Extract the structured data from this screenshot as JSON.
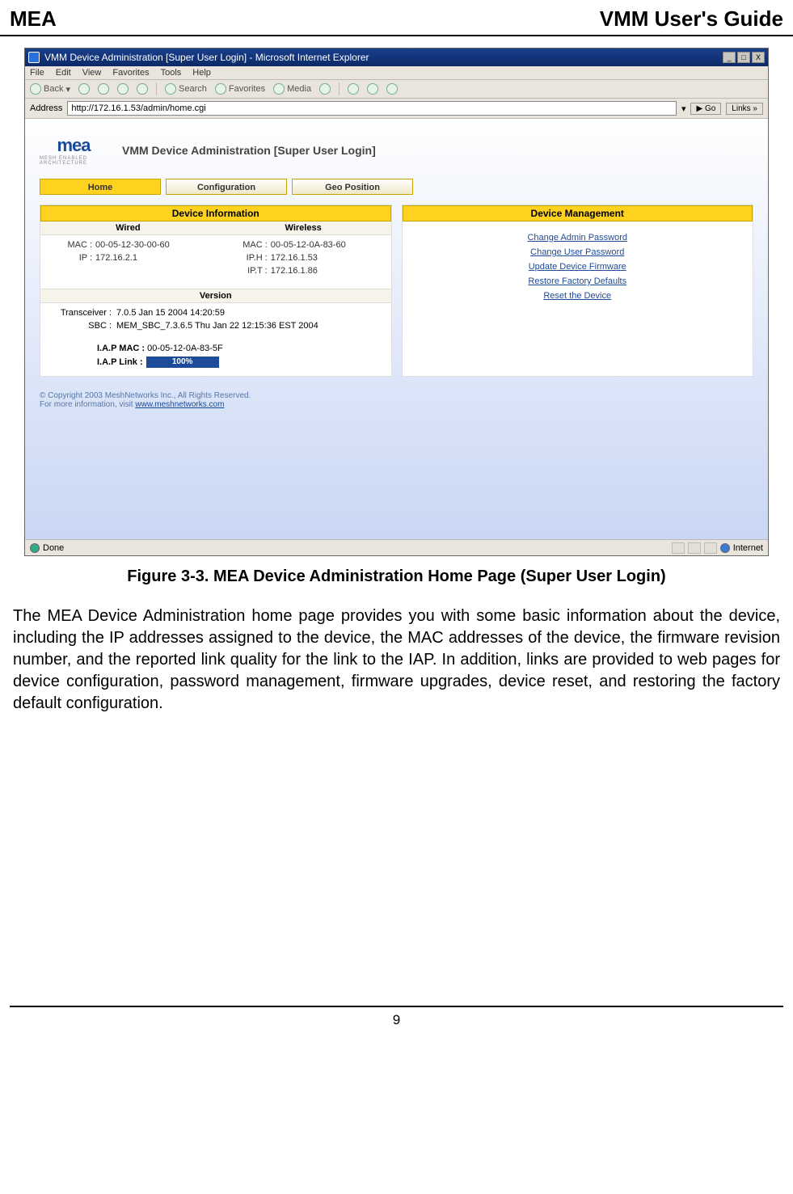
{
  "doc_header": {
    "left": "MEA",
    "right": "VMM User's Guide"
  },
  "titlebar": {
    "text": "VMM Device Administration [Super User Login] - Microsoft Internet Explorer"
  },
  "win_btns": {
    "min": "_",
    "max": "□",
    "close": "X"
  },
  "menubar": [
    "File",
    "Edit",
    "View",
    "Favorites",
    "Tools",
    "Help"
  ],
  "toolbar": {
    "back": "Back",
    "search": "Search",
    "favorites": "Favorites",
    "media": "Media"
  },
  "addressbar": {
    "label": "Address",
    "url": "http://172.16.1.53/admin/home.cgi",
    "go": "Go",
    "links": "Links"
  },
  "app_title": "VMM Device Administration [Super User Login]",
  "logo": {
    "text": "mea",
    "sub": "MESH ENABLED ARCHITECTURE"
  },
  "tabs": {
    "home": "Home",
    "config": "Configuration",
    "geo": "Geo Position"
  },
  "device_info": {
    "header": "Device Information",
    "wired_h": "Wired",
    "wireless_h": "Wireless",
    "wired": {
      "mac_k": "MAC :",
      "mac_v": "00-05-12-30-00-60",
      "ip_k": "IP :",
      "ip_v": "172.16.2.1"
    },
    "wireless": {
      "mac_k": "MAC :",
      "mac_v": "00-05-12-0A-83-60",
      "iph_k": "IP.H :",
      "iph_v": "172.16.1.53",
      "ipt_k": "IP.T :",
      "ipt_v": "172.16.1.86"
    },
    "version_h": "Version",
    "version": {
      "trans_k": "Transceiver :",
      "trans_v": "7.0.5 Jan 15 2004 14:20:59",
      "sbc_k": "SBC :",
      "sbc_v": "MEM_SBC_7.3.6.5 Thu Jan 22 12:15:36 EST 2004"
    },
    "iap": {
      "mac_k": "I.A.P MAC :",
      "mac_v": "00-05-12-0A-83-5F",
      "link_k": "I.A.P Link :",
      "link_v": "100%"
    }
  },
  "device_mgmt": {
    "header": "Device Management",
    "links": {
      "admin_pw": "Change Admin Password",
      "user_pw": "Change User Password",
      "firmware": "Update Device Firmware",
      "restore": "Restore Factory Defaults",
      "reset": "Reset the Device"
    }
  },
  "copyright": {
    "line1": "© Copyright 2003 MeshNetworks Inc., All Rights Reserved.",
    "line2_pre": "For more information, visit ",
    "link": "www.meshnetworks.com"
  },
  "statusbar": {
    "done": "Done",
    "internet": "Internet"
  },
  "figure_caption": "Figure 3-3.     MEA Device Administration Home Page (Super User Login)",
  "para": "The MEA Device Administration home page provides you with some basic information about the device, including the IP addresses assigned to the device, the MAC addresses of the device, the firmware revision number, and the reported link quality for the link to the IAP. In addition, links are provided to web pages for device configuration, password management, firmware upgrades, device reset, and restoring the factory default configuration.",
  "page_num": "9"
}
